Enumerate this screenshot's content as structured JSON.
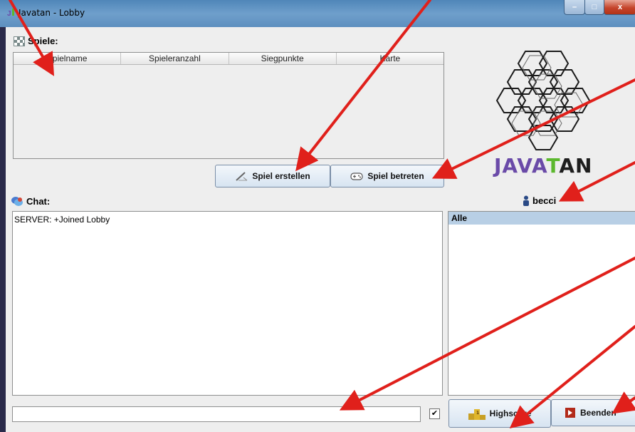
{
  "window": {
    "title": "Javatan - Lobby",
    "app_icon_text": "J",
    "controls": {
      "minimize": "–",
      "maximize": "□",
      "close": "x"
    }
  },
  "games": {
    "label": "Spiele:",
    "icon": "checkerboard-icon",
    "columns": [
      "Spielname",
      "Spieleranzahl",
      "Siegpunkte",
      "Karte"
    ],
    "rows": []
  },
  "buttons": {
    "create_game": "Spiel erstellen",
    "join_game": "Spiel betreten",
    "highscore": "Highscore",
    "quit": "Beenden"
  },
  "logo": {
    "parts": [
      {
        "text": "JAVA",
        "color": "#6a4aa8"
      },
      {
        "text": "T",
        "color": "#5cb82e"
      },
      {
        "text": "AN",
        "color": "#1e1e1e"
      }
    ]
  },
  "chat": {
    "label": "Chat:",
    "icon": "chat-bubbles-icon",
    "messages": [
      "SERVER: +Joined Lobby"
    ],
    "input_value": "",
    "checkbox_checked": true
  },
  "user": {
    "name": "becci",
    "icon": "user-icon"
  },
  "recipients": {
    "items": [
      "Alle"
    ],
    "selected": "Alle"
  },
  "colors": {
    "accent_arrow": "#e0201b",
    "selection": "#b8cfe5"
  }
}
